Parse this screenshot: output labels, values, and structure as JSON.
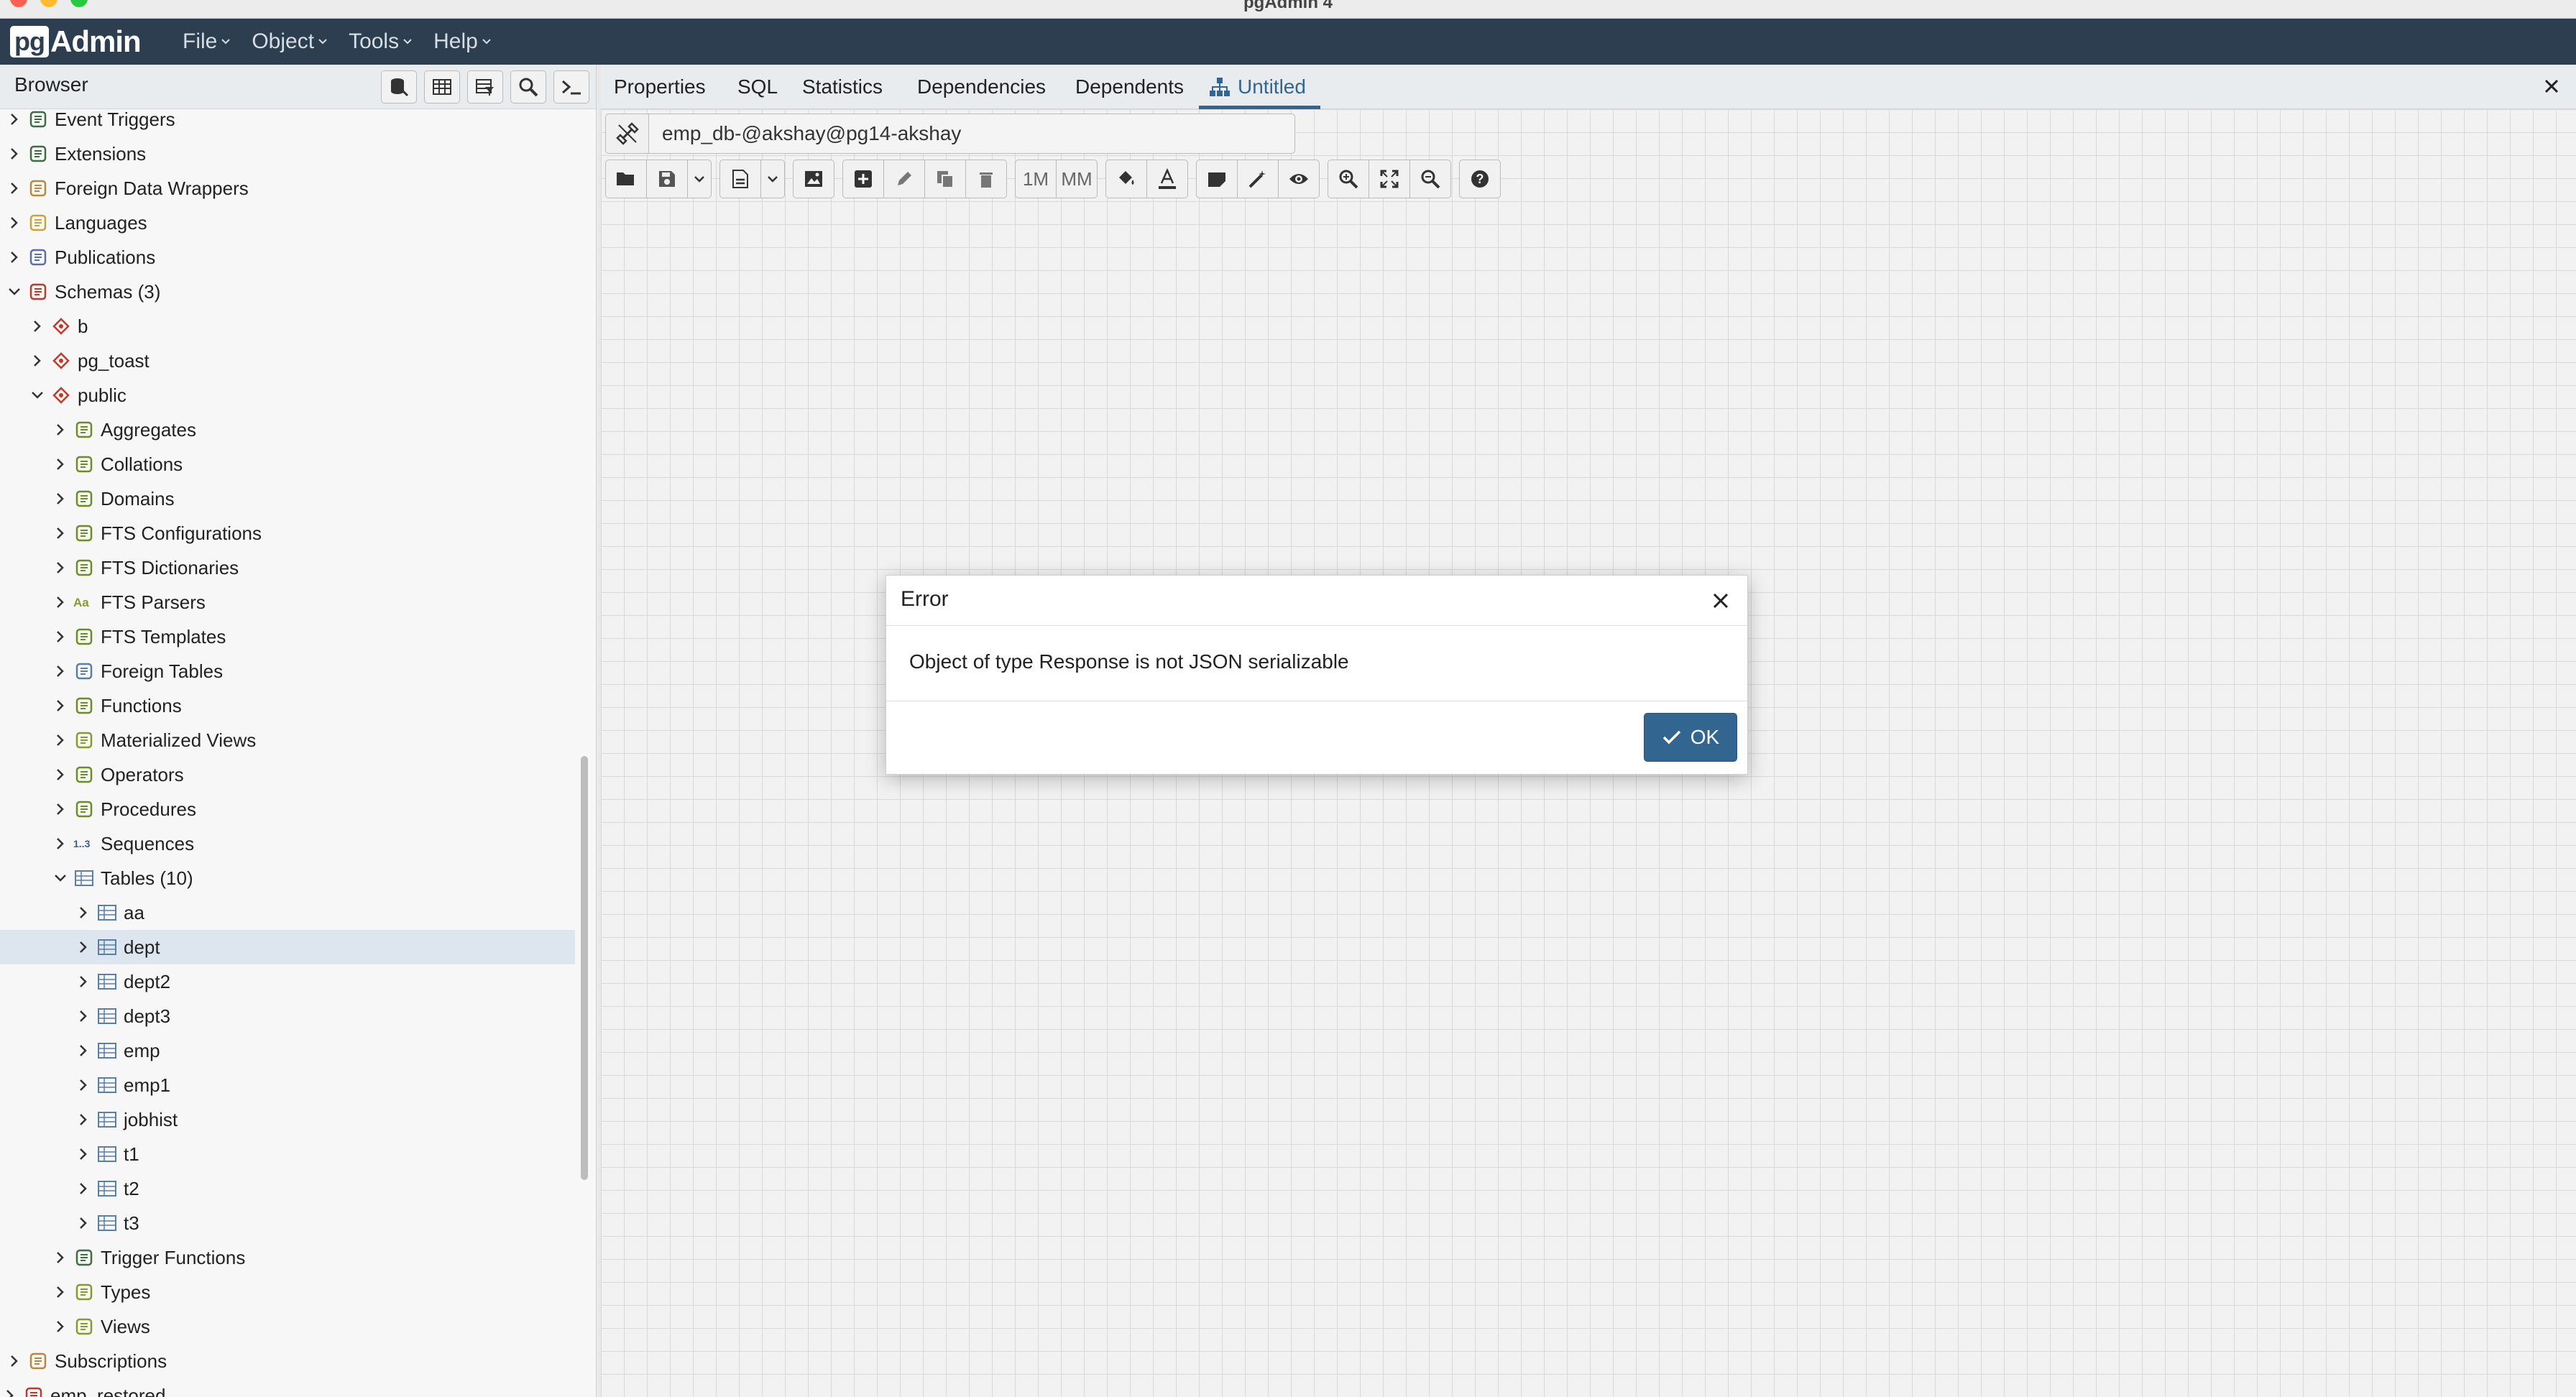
{
  "window": {
    "title": "pgAdmin 4"
  },
  "navbar": {
    "logo_badge": "pg",
    "logo_text": "Admin",
    "menu": [
      {
        "label": "File"
      },
      {
        "label": "Object"
      },
      {
        "label": "Tools"
      },
      {
        "label": "Help"
      }
    ]
  },
  "browser": {
    "title": "Browser",
    "toolbar_icons": [
      "query-tool-icon",
      "view-data-icon",
      "filtered-rows-icon",
      "search-icon",
      "psql-terminal-icon"
    ],
    "tree": [
      {
        "label": "Event Triggers",
        "icon": "event-trigger-icon",
        "expanded": false
      },
      {
        "label": "Extensions",
        "icon": "extension-icon",
        "expanded": false
      },
      {
        "label": "Foreign Data Wrappers",
        "icon": "fdw-icon",
        "expanded": false
      },
      {
        "label": "Languages",
        "icon": "language-icon",
        "expanded": false
      },
      {
        "label": "Publications",
        "icon": "publication-icon",
        "expanded": false
      },
      {
        "label": "Schemas (3)",
        "icon": "schemas-icon",
        "expanded": true
      },
      {
        "label": "b",
        "icon": "schema-icon",
        "expanded": false
      },
      {
        "label": "pg_toast",
        "icon": "schema-icon",
        "expanded": false
      },
      {
        "label": "public",
        "icon": "schema-icon",
        "expanded": true
      },
      {
        "label": "Aggregates",
        "icon": "aggregate-icon",
        "expanded": false
      },
      {
        "label": "Collations",
        "icon": "collation-icon",
        "expanded": false
      },
      {
        "label": "Domains",
        "icon": "domain-icon",
        "expanded": false
      },
      {
        "label": "FTS Configurations",
        "icon": "fts-configuration-icon",
        "expanded": false
      },
      {
        "label": "FTS Dictionaries",
        "icon": "fts-dictionary-icon",
        "expanded": false
      },
      {
        "label": "FTS Parsers",
        "icon": "fts-parser-icon",
        "expanded": false
      },
      {
        "label": "FTS Templates",
        "icon": "fts-template-icon",
        "expanded": false
      },
      {
        "label": "Foreign Tables",
        "icon": "foreign-table-icon",
        "expanded": false
      },
      {
        "label": "Functions",
        "icon": "function-icon",
        "expanded": false
      },
      {
        "label": "Materialized Views",
        "icon": "materialized-view-icon",
        "expanded": false
      },
      {
        "label": "Operators",
        "icon": "operator-icon",
        "expanded": false
      },
      {
        "label": "Procedures",
        "icon": "procedure-icon",
        "expanded": false
      },
      {
        "label": "Sequences",
        "icon": "sequence-icon",
        "expanded": false
      },
      {
        "label": "Tables (10)",
        "icon": "tables-icon",
        "expanded": true
      },
      {
        "label": "aa",
        "icon": "table-icon",
        "expanded": false
      },
      {
        "label": "dept",
        "icon": "table-icon",
        "expanded": false,
        "selected": true
      },
      {
        "label": "dept2",
        "icon": "table-icon",
        "expanded": false
      },
      {
        "label": "dept3",
        "icon": "table-icon",
        "expanded": false
      },
      {
        "label": "emp",
        "icon": "table-icon",
        "expanded": false
      },
      {
        "label": "emp1",
        "icon": "table-icon",
        "expanded": false
      },
      {
        "label": "jobhist",
        "icon": "table-icon",
        "expanded": false
      },
      {
        "label": "t1",
        "icon": "table-icon",
        "expanded": false
      },
      {
        "label": "t2",
        "icon": "table-icon",
        "expanded": false
      },
      {
        "label": "t3",
        "icon": "table-icon",
        "expanded": false
      },
      {
        "label": "Trigger Functions",
        "icon": "trigger-function-icon",
        "expanded": false
      },
      {
        "label": "Types",
        "icon": "type-icon",
        "expanded": false
      },
      {
        "label": "Views",
        "icon": "view-icon",
        "expanded": false
      },
      {
        "label": "Subscriptions",
        "icon": "subscription-icon",
        "expanded": false
      },
      {
        "label": "emp_restored",
        "icon": "database-icon",
        "expanded": false
      }
    ]
  },
  "tabs": [
    {
      "label": "Properties"
    },
    {
      "label": "SQL"
    },
    {
      "label": "Statistics"
    },
    {
      "label": "Dependencies"
    },
    {
      "label": "Dependents"
    },
    {
      "label": "Untitled",
      "active": true,
      "icon": "erd-icon"
    }
  ],
  "erd": {
    "connection": "emp_db-@akshay@pg14-akshay",
    "toolbar": {
      "one_to_many": "1M",
      "many_to_many": "MM"
    }
  },
  "dialog": {
    "title": "Error",
    "message": "Object of type Response is not JSON serializable",
    "ok_label": "OK"
  },
  "colors": {
    "navbar": "#2c3e50",
    "accent": "#326690",
    "selected_row": "#dde5ee"
  }
}
